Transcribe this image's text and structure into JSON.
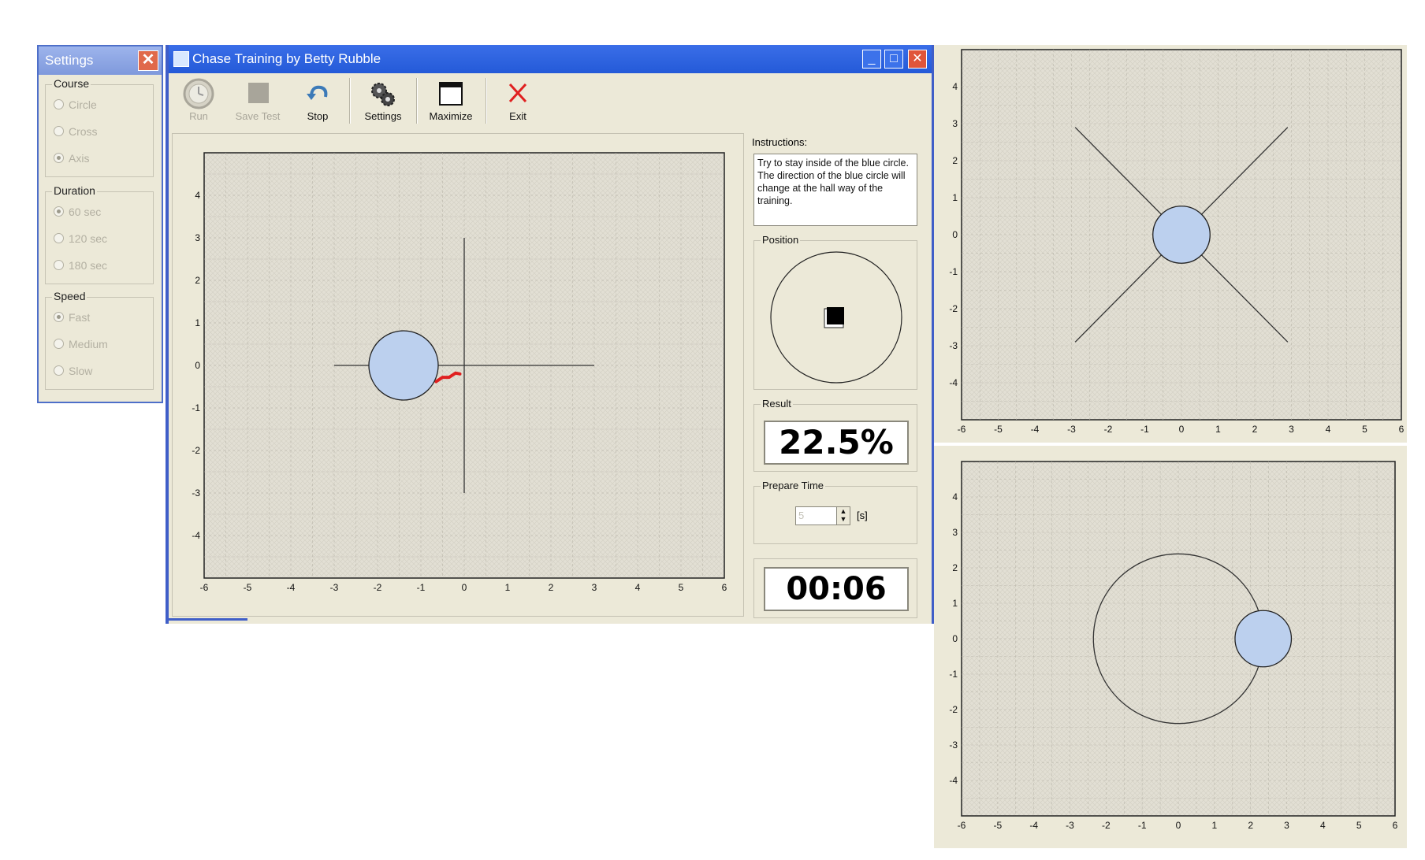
{
  "settings_window": {
    "title": "Settings",
    "groups": [
      {
        "label": "Course",
        "options": [
          {
            "label": "Circle",
            "selected": false
          },
          {
            "label": "Cross",
            "selected": false
          },
          {
            "label": "Axis",
            "selected": true
          }
        ]
      },
      {
        "label": "Duration",
        "options": [
          {
            "label": "60 sec",
            "selected": true
          },
          {
            "label": "120 sec",
            "selected": false
          },
          {
            "label": "180 sec",
            "selected": false
          }
        ]
      },
      {
        "label": "Speed",
        "options": [
          {
            "label": "Fast",
            "selected": true
          },
          {
            "label": "Medium",
            "selected": false
          },
          {
            "label": "Slow",
            "selected": false
          }
        ]
      }
    ]
  },
  "main_window": {
    "title": "Chase Training by Betty  Rubble",
    "toolbar": [
      {
        "label": "Run",
        "icon": "clock-icon",
        "enabled": false
      },
      {
        "label": "Save Test",
        "icon": "save-icon",
        "enabled": false
      },
      {
        "label": "Stop",
        "icon": "undo-arrow-icon",
        "enabled": true
      },
      {
        "label": "Settings",
        "icon": "gears-icon",
        "enabled": true
      },
      {
        "label": "Maximize",
        "icon": "window-icon",
        "enabled": true
      },
      {
        "label": "Exit",
        "icon": "x-icon",
        "enabled": true
      }
    ],
    "instructions_label": "Instructions:",
    "instructions_text": "Try to stay inside of the blue circle. The direction of the blue circle will change at the hall way of the training.",
    "position_label": "Position",
    "result_label": "Result",
    "result_value": "22.5%",
    "prepare_label": "Prepare Time",
    "prepare_value": "5",
    "prepare_unit": "[s]",
    "timer": "00:06"
  },
  "chart_data": [
    {
      "type": "scatter",
      "name": "main-plot",
      "mode": "Axis",
      "xlim": [
        -6,
        6
      ],
      "ylim": [
        -5,
        5
      ],
      "xticks": [
        -6,
        -5,
        -4,
        -3,
        -2,
        -1,
        0,
        1,
        2,
        3,
        4,
        5,
        6
      ],
      "yticks": [
        4,
        3,
        2,
        1,
        0,
        -1,
        -2,
        -3,
        -4
      ],
      "course_lines": [
        [
          [
            -3,
            0
          ],
          [
            3,
            0
          ]
        ],
        [
          [
            0,
            -3
          ],
          [
            0,
            3
          ]
        ]
      ],
      "target": {
        "x": -1.4,
        "y": 0,
        "r": 0.8
      },
      "trace": [
        [
          -0.65,
          -0.38
        ],
        [
          -0.5,
          -0.28
        ],
        [
          -0.35,
          -0.28
        ],
        [
          -0.2,
          -0.18
        ],
        [
          -0.1,
          -0.2
        ]
      ]
    },
    {
      "type": "scatter",
      "name": "cross-plot",
      "mode": "Cross",
      "xlim": [
        -6,
        6
      ],
      "ylim": [
        -5,
        5
      ],
      "xticks": [
        -6,
        -5,
        -4,
        -3,
        -2,
        -1,
        0,
        1,
        2,
        3,
        4,
        5,
        6
      ],
      "yticks": [
        4,
        3,
        2,
        1,
        0,
        -1,
        -2,
        -3,
        -4
      ],
      "course_lines": [
        [
          [
            -2.9,
            2.9
          ],
          [
            2.9,
            -2.9
          ]
        ],
        [
          [
            -2.9,
            -2.9
          ],
          [
            2.9,
            2.9
          ]
        ]
      ],
      "target": {
        "x": 0,
        "y": 0,
        "r": 0.78
      }
    },
    {
      "type": "scatter",
      "name": "circle-plot",
      "mode": "Circle",
      "xlim": [
        -6,
        6
      ],
      "ylim": [
        -5,
        5
      ],
      "xticks": [
        -6,
        -5,
        -4,
        -3,
        -2,
        -1,
        0,
        1,
        2,
        3,
        4,
        5,
        6
      ],
      "yticks": [
        4,
        3,
        2,
        1,
        0,
        -1,
        -2,
        -3,
        -4
      ],
      "course_circle": {
        "x": 0,
        "y": 0,
        "r": 2.35
      },
      "target": {
        "x": 2.35,
        "y": 0,
        "r": 0.78
      }
    }
  ],
  "colors": {
    "target_fill": "#bcd0ee",
    "trace": "#e02020",
    "plot_bg": "#e2dfd4",
    "grid": "#b9b6aa"
  }
}
